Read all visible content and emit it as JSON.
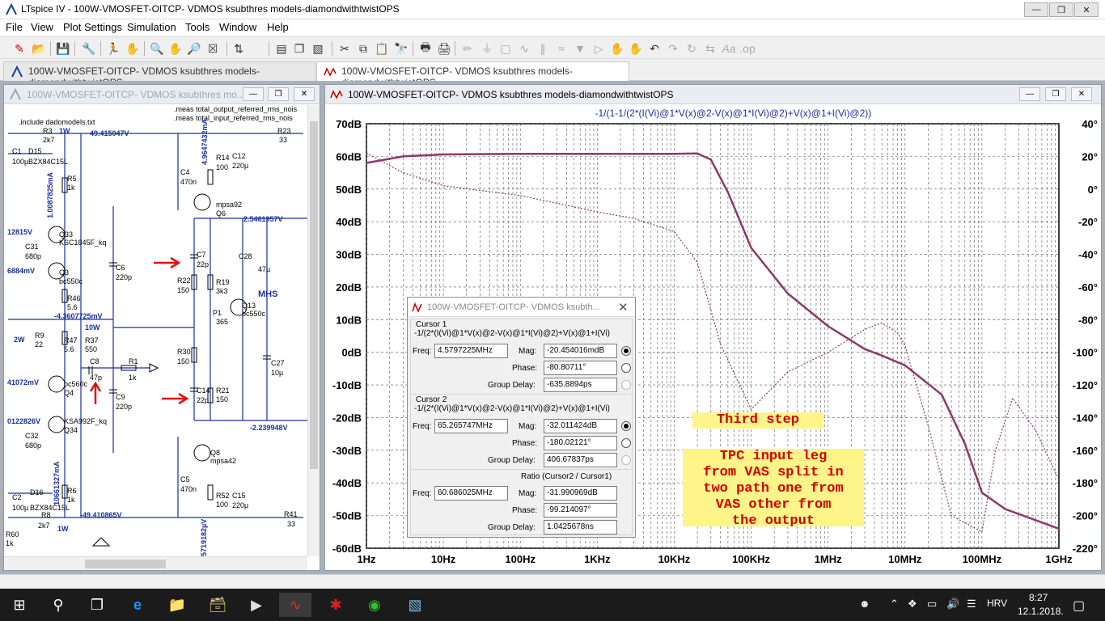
{
  "app": {
    "title": "LTspice IV - 100W-VMOSFET-OITCP- VDMOS ksubthres models-diamondwithtwistOPS"
  },
  "menu": [
    "File",
    "View",
    "Plot Settings",
    "Simulation",
    "Tools",
    "Window",
    "Help"
  ],
  "tabs": [
    {
      "label": "100W-VMOSFET-OITCP- VDMOS ksubthres models-diamondwithtwistOPS"
    },
    {
      "label": "100W-VMOSFET-OITCP- VDMOS ksubthres models-diamondwithtwistOPS"
    }
  ],
  "schematic_window": {
    "title": "100W-VMOSFET-OITCP- VDMOS ksubthres mo..."
  },
  "schematic_labels": [
    ".include dadomodels.txt",
    ".meas total_output_referred_rms_nois",
    ".meas total_input_referred_rms_nois",
    "R3",
    "2k7",
    "1W",
    "49.415047V",
    "R23",
    "33",
    "C1",
    "D15",
    "100µ",
    "BZX84C15L",
    "R5",
    "1k",
    "1.0087825mA",
    "Q33",
    "KSC1845F_kq",
    "12815V",
    "C31",
    "680p",
    "Q3",
    "bc550c",
    "6884mV",
    "R46",
    "5.6",
    "-4.3607725mV",
    "2W",
    "R9",
    "22",
    "R47",
    "5.6",
    "R37",
    "550",
    "10W",
    "C8",
    "47p",
    "R1",
    "1k",
    "41072mV",
    "bc560c",
    "Q4",
    "C9",
    "220p",
    "0122826V",
    "KSA992F_kq",
    "Q34",
    "C32",
    "680p",
    "10661327mA",
    "R6",
    "1k",
    "C2",
    "D16",
    "100µ",
    "BZX84C15L",
    "R8",
    "2k7",
    "1W",
    "-49.410865V",
    "R60",
    "1k",
    "C4",
    "470n",
    "R14",
    "100",
    "C12",
    "220µ",
    "mpsa92",
    "Q6",
    "2.5461957V",
    "C6",
    "220p",
    "C7",
    "22p",
    "C28",
    "47µ",
    "R22",
    "150",
    "R19",
    "3k3",
    "P1",
    "365",
    "Q13",
    "bc550c",
    "MHS",
    "R30",
    "150",
    "C27",
    "10µ",
    "C14",
    "22p",
    "R21",
    "150",
    "-2.239948V",
    "Q8",
    "mpsa42",
    "C5",
    "470n",
    "R52",
    "100",
    "C15",
    "220µ",
    "R41",
    "33",
    "5719182µV",
    "4.9647432mA"
  ],
  "plot_window": {
    "title": "100W-VMOSFET-OITCP- VDMOS ksubthres models-diamondwithtwistOPS",
    "trace_label": "-1/(1-1/(2*(I(Vi)@1*V(x)@2-V(x)@1*I(Vi)@2)+V(x)@1+I(Vi)@2))"
  },
  "chart_data": {
    "type": "line",
    "title": "-1/(1-1/(2*(I(Vi)@1*V(x)@2-V(x)@1*I(Vi)@2)+V(x)@1+I(Vi)@2))",
    "xscale": "log",
    "xlim": [
      1,
      1000000000
    ],
    "xticks": [
      "1Hz",
      "10Hz",
      "100Hz",
      "1KHz",
      "10KHz",
      "100KHz",
      "1MHz",
      "10MHz",
      "100MHz",
      "1GHz"
    ],
    "ylim_left": [
      -60,
      70
    ],
    "yticks_left": [
      "70dB",
      "60dB",
      "50dB",
      "40dB",
      "30dB",
      "20dB",
      "10dB",
      "0dB",
      "-10dB",
      "-20dB",
      "-30dB",
      "-40dB",
      "-50dB",
      "-60dB"
    ],
    "ylim_right": [
      -220,
      40
    ],
    "yticks_right": [
      "40°",
      "20°",
      "0°",
      "-20°",
      "-40°",
      "-60°",
      "-80°",
      "-100°",
      "-120°",
      "-140°",
      "-160°",
      "-180°",
      "-200°",
      "-220°"
    ],
    "grid": true,
    "colors": {
      "trace": "#8b3a6b",
      "background": "#ffffff"
    },
    "series": [
      {
        "role": "magnitude",
        "x": [
          1,
          3,
          10,
          100,
          1000,
          10000,
          20000,
          30000,
          50000,
          100000,
          300000,
          1000000,
          3000000,
          5000000,
          10000000,
          30000000,
          60000000,
          100000000,
          200000000,
          1000000000
        ],
        "y": [
          58,
          60,
          60.6,
          60.8,
          60.8,
          60.8,
          60.9,
          59,
          49,
          32,
          18,
          8,
          1,
          -1,
          -4,
          -13,
          -28,
          -43,
          -48,
          -54
        ]
      },
      {
        "role": "phase",
        "x": [
          1,
          3,
          10,
          100,
          1000,
          3000,
          10000,
          20000,
          40000,
          100000,
          300000,
          1000000,
          3000000,
          5000000,
          8000000,
          10000000,
          20000000,
          40000000,
          100000000,
          150000000,
          250000000,
          500000000,
          1000000000
        ],
        "y": [
          22,
          10,
          2,
          -4,
          -14,
          -18,
          -26,
          -45,
          -95,
          -135,
          -112,
          -100,
          -86,
          -82,
          -88,
          -96,
          -145,
          -200,
          -210,
          -160,
          -128,
          -148,
          -178
        ]
      }
    ]
  },
  "cursor_dialog": {
    "title": "100W-VMOSFET-OITCP- VDMOS ksubth...",
    "cursor1": {
      "heading": "Cursor 1",
      "expr": "-1/(2*(I(Vi)@1*V(x)@2-V(x)@1*I(Vi)@2)+V(x)@1+I(Vi)",
      "freq": "4.5797225MHz",
      "mag": "-20.454016mdB",
      "phase": "-80.80711°",
      "group_delay": "-635.8894ps"
    },
    "cursor2": {
      "heading": "Cursor 2",
      "expr": "-1/(2*(I(Vi)@1*V(x)@2-V(x)@1*I(Vi)@2)+V(x)@1+I(Vi)",
      "freq": "65.265747MHz",
      "mag": "-32.011424dB",
      "phase": "-180.02121°",
      "group_delay": "406.67837ps"
    },
    "ratio": {
      "heading": "Ratio (Cursor2 / Cursor1)",
      "freq": "60.686025MHz",
      "mag": "-31.990969dB",
      "phase": "-99.214097°",
      "group_delay": "1.0425678ns"
    },
    "labels": {
      "freq": "Freq:",
      "mag": "Mag:",
      "phase": "Phase:",
      "group_delay": "Group Delay:"
    }
  },
  "notes": {
    "step": "Third step",
    "tpc": [
      "TPC input leg",
      "from VAS split in",
      "two path one from",
      "VAS other from",
      "the output"
    ]
  },
  "taskbar": {
    "lang": "HRV",
    "time": "8:27",
    "date": "12.1.2018."
  }
}
